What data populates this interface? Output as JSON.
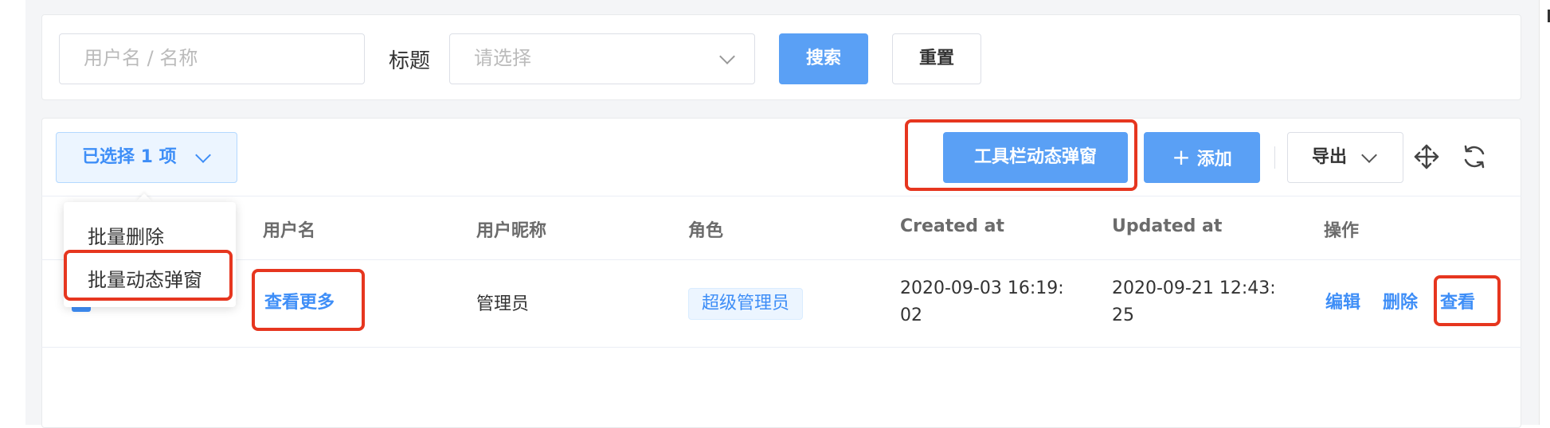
{
  "search": {
    "username_placeholder": "用户名 / 名称",
    "title_label": "标题",
    "title_placeholder": "请选择",
    "search_button": "搜索",
    "reset_button": "重置"
  },
  "toolbar": {
    "selected_label": "已选择 1 项",
    "dynamic_dialog_button": "工具栏动态弹窗",
    "add_button": "添加",
    "add_icon": "+",
    "export_button": "导出"
  },
  "batch_menu": {
    "items": [
      "批量删除",
      "批量动态弹窗"
    ]
  },
  "table": {
    "columns": [
      "用户名",
      "用户昵称",
      "角色",
      "Created at",
      "Updated at",
      "操作"
    ],
    "rows": [
      {
        "username": "查看更多",
        "nickname": "管理员",
        "role": "超级管理员",
        "created_at": [
          "2020-09-03 16:19:",
          "02"
        ],
        "updated_at": [
          "2020-09-21 12:43:",
          "25"
        ],
        "actions": [
          "编辑",
          "删除",
          "查看"
        ]
      }
    ]
  },
  "colors": {
    "primary": "#5aa0f5",
    "link": "#3e8ef7",
    "highlight": "#e6361f"
  }
}
